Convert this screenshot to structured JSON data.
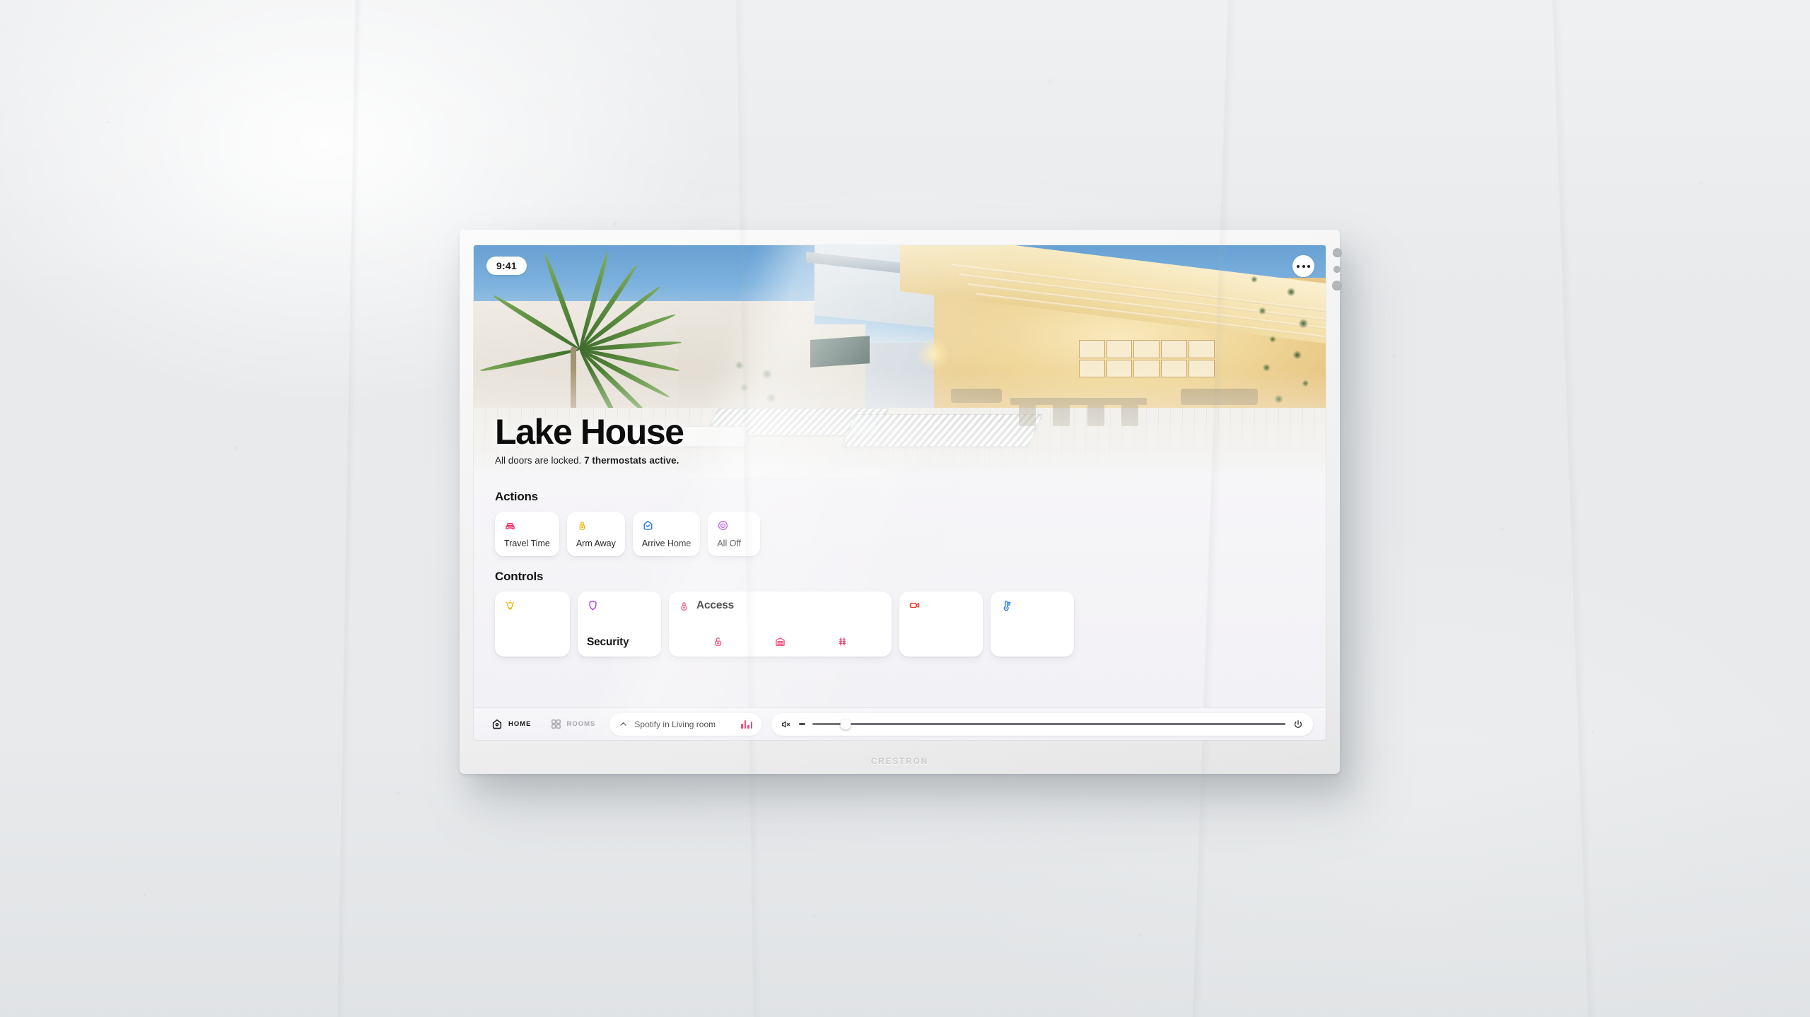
{
  "device": {
    "brand": "CRESTRON"
  },
  "status_bar": {
    "time": "9:41",
    "more_icon": "more-horizontal-icon"
  },
  "hero": {
    "title": "Lake House",
    "subtitle_plain": "All doors are locked. ",
    "subtitle_bold": "7 thermostats active."
  },
  "sections": {
    "actions_title": "Actions",
    "controls_title": "Controls"
  },
  "actions": [
    {
      "label": "Travel Time",
      "icon": "car-icon",
      "color": "#ee2a60"
    },
    {
      "label": "Arm Away",
      "icon": "lock-icon",
      "color": "#edb60a"
    },
    {
      "label": "Arrive Home",
      "icon": "home-check-icon",
      "color": "#1a73e8"
    },
    {
      "label": "All Off",
      "icon": "power-icon",
      "color": "#a932e0"
    }
  ],
  "controls": [
    {
      "name": "lighting",
      "label": "",
      "icon": "lightbulb-icon",
      "color": "#edb60a",
      "size": "sm"
    },
    {
      "name": "security",
      "label": "Security",
      "icon": "shield-icon",
      "color": "#a932e0",
      "size": "md"
    },
    {
      "name": "access",
      "label": "Access",
      "icon": "lock-round-icon",
      "color": "#ee2a60",
      "size": "wide",
      "sub_icons": [
        {
          "icon": "unlock-icon",
          "color": "#ee2a60"
        },
        {
          "icon": "garage-door-icon",
          "color": "#ee2a60"
        },
        {
          "icon": "gate-icon",
          "color": "#ee2a60"
        }
      ]
    },
    {
      "name": "cameras",
      "label": "",
      "icon": "video-camera-icon",
      "color": "#f03125",
      "size": "md"
    },
    {
      "name": "climate",
      "label": "",
      "icon": "thermometer-icon",
      "color": "#1a73e8",
      "size": "md"
    }
  ],
  "bottom_bar": {
    "nav": [
      {
        "label": "HOME",
        "icon": "home-icon",
        "active": true
      },
      {
        "label": "ROOMS",
        "icon": "grid-icon",
        "active": false
      }
    ],
    "media": {
      "expand_icon": "chevron-up-icon",
      "label": "Spotify in Living room",
      "equalizer_icon": "equalizer-icon",
      "equalizer_color": "#ef2a5b"
    },
    "volume": {
      "mute_icon": "speaker-muted-icon",
      "level_percent": 7,
      "power_icon": "power-icon"
    }
  }
}
